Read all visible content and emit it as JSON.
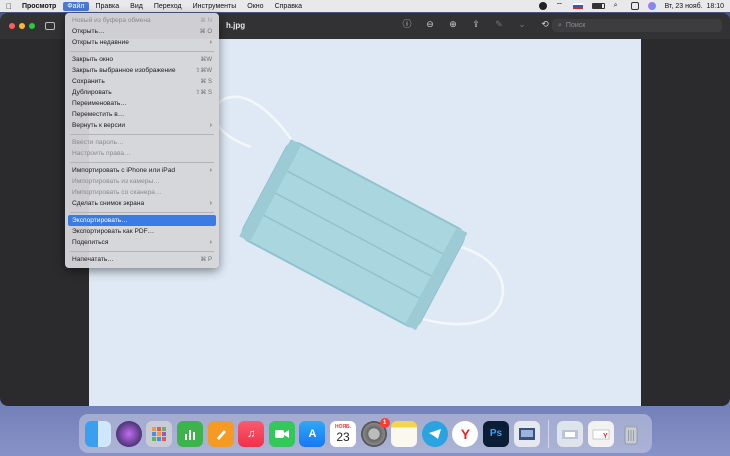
{
  "menubar": {
    "app": "Просмотр",
    "items": [
      "Файл",
      "Правка",
      "Вид",
      "Переход",
      "Инструменты",
      "Окно",
      "Справка"
    ],
    "datetime": "Вт, 23 нояб.  18:10"
  },
  "window": {
    "doc_title": "h.jpg",
    "search_placeholder": "Поиск"
  },
  "file_menu": {
    "items": [
      {
        "label": "Новый из буфера обмена",
        "shortcut": "⌘ N"
      },
      {
        "label": "Открыть…",
        "shortcut": "⌘ O"
      },
      {
        "label": "Открыть недавние",
        "arrow": "›"
      },
      {
        "label": "Закрыть окно",
        "shortcut": "⌘W"
      },
      {
        "label": "Закрыть выбранное изображение",
        "shortcut": "⇧⌘W"
      },
      {
        "label": "Сохранить",
        "shortcut": "⌘ S"
      },
      {
        "label": "Дублировать",
        "shortcut": "⇧⌘ S"
      },
      {
        "label": "Переименовать…"
      },
      {
        "label": "Переместить в…"
      },
      {
        "label": "Вернуть к версии",
        "arrow": "›"
      },
      {
        "label": "Ввести пароль…"
      },
      {
        "label": "Настроить права…"
      },
      {
        "label": "Импортировать с iPhone или iPad",
        "arrow": "›"
      },
      {
        "label": "Импортировать из камеры…"
      },
      {
        "label": "Импортировать со сканера…"
      },
      {
        "label": "Сделать снимок экрана",
        "arrow": "›"
      },
      {
        "label": "Экспортировать…"
      },
      {
        "label": "Экспортировать как PDF…"
      },
      {
        "label": "Поделиться",
        "arrow": "›"
      },
      {
        "label": "Напечатать…",
        "shortcut": "⌘ P"
      }
    ]
  },
  "dock": {
    "calendar_month": "НОЯБ.",
    "calendar_day": "23",
    "settings_badge": "1",
    "photoshop_label": "Ps"
  },
  "colors": {
    "menu_highlight": "#3b7be2",
    "image_background": "#dfe9f5",
    "mask": "#a9d6df"
  }
}
